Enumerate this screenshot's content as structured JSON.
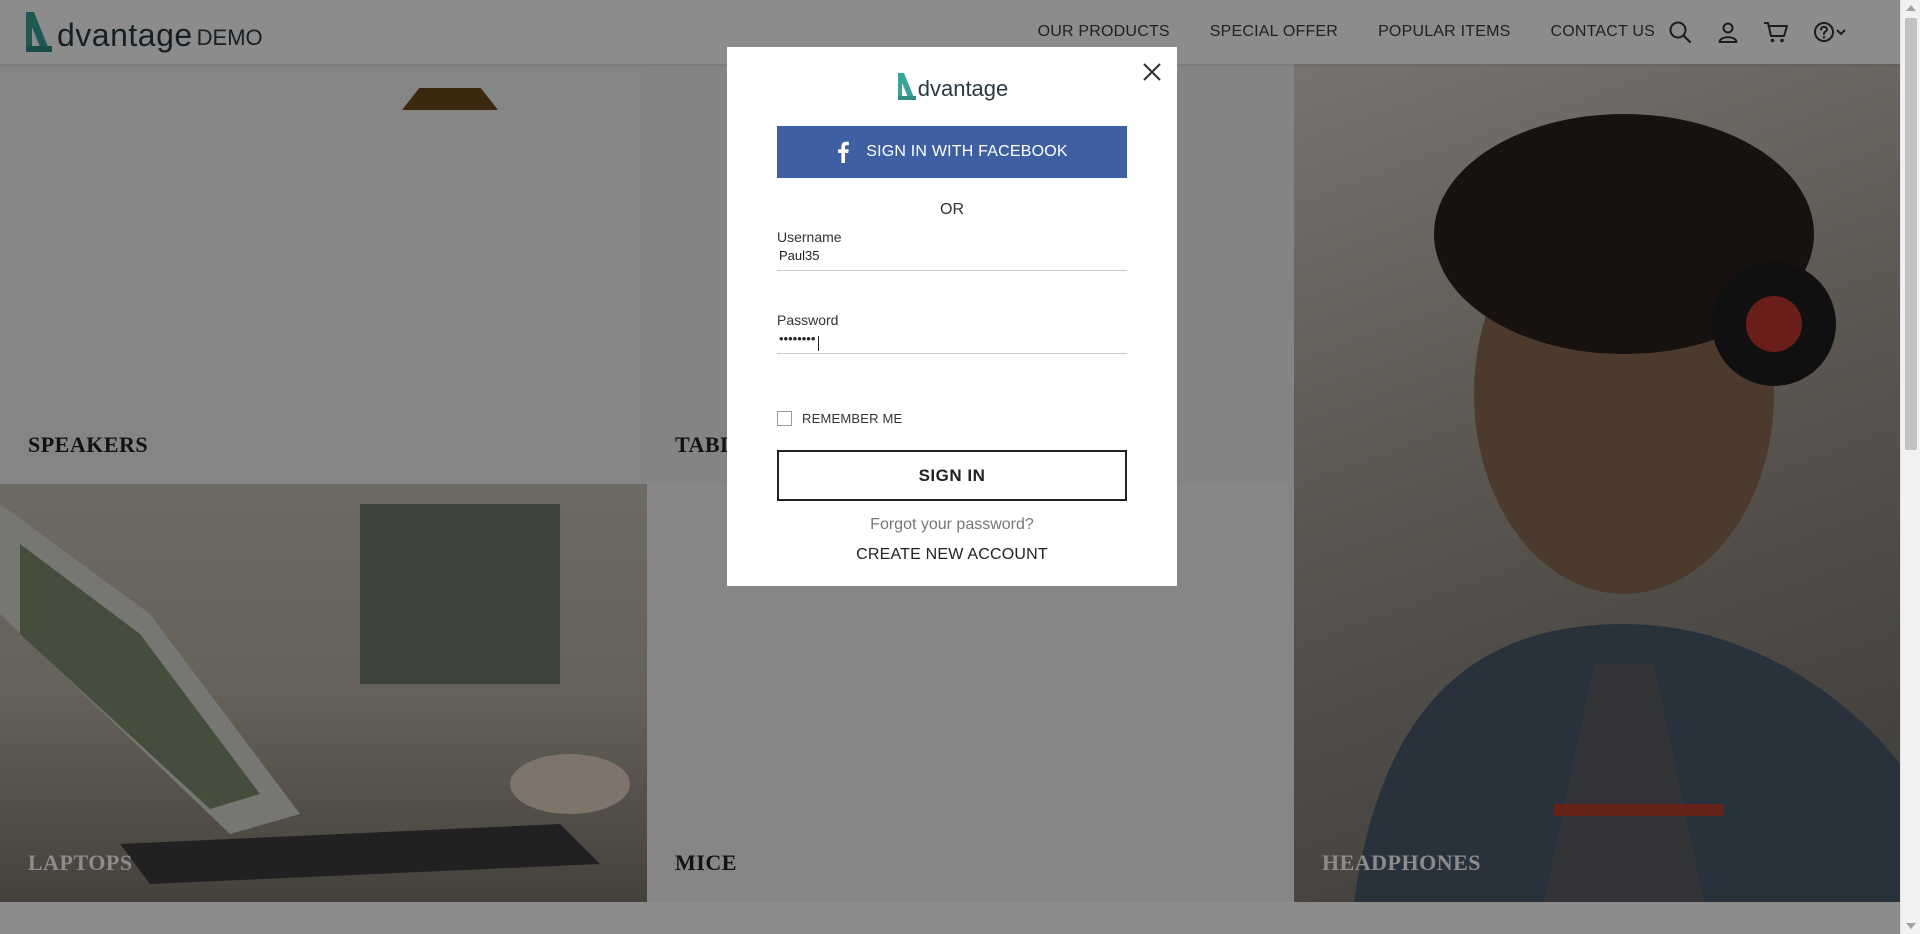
{
  "header": {
    "brand_word": "dvantage",
    "brand_suffix": "DEMO",
    "nav": [
      "OUR PRODUCTS",
      "SPECIAL OFFER",
      "POPULAR ITEMS",
      "CONTACT US"
    ],
    "icons": [
      "search-icon",
      "user-icon",
      "cart-icon",
      "help-icon",
      "chevron-down-icon"
    ]
  },
  "categories": {
    "speakers": "SPEAKERS",
    "tablets": "TABLETS",
    "headphones": "HEADPHONES",
    "laptops": "LAPTOPS",
    "mice": "MICE"
  },
  "login_modal": {
    "logo_word": "dvantage",
    "facebook_label": "SIGN IN WITH FACEBOOK",
    "or_label": "OR",
    "username_label": "Username",
    "username_value": "Paul35",
    "password_label": "Password",
    "password_value": "••••••••",
    "remember_label": "REMEMBER ME",
    "remember_checked": false,
    "signin_label": "SIGN IN",
    "forgot_label": "Forgot your password?",
    "create_label": "CREATE NEW ACCOUNT"
  },
  "colors": {
    "accent_teal": "#3aa39a",
    "facebook_blue": "#3f5fa3",
    "overlay": "rgba(0,0,0,0.45)"
  }
}
